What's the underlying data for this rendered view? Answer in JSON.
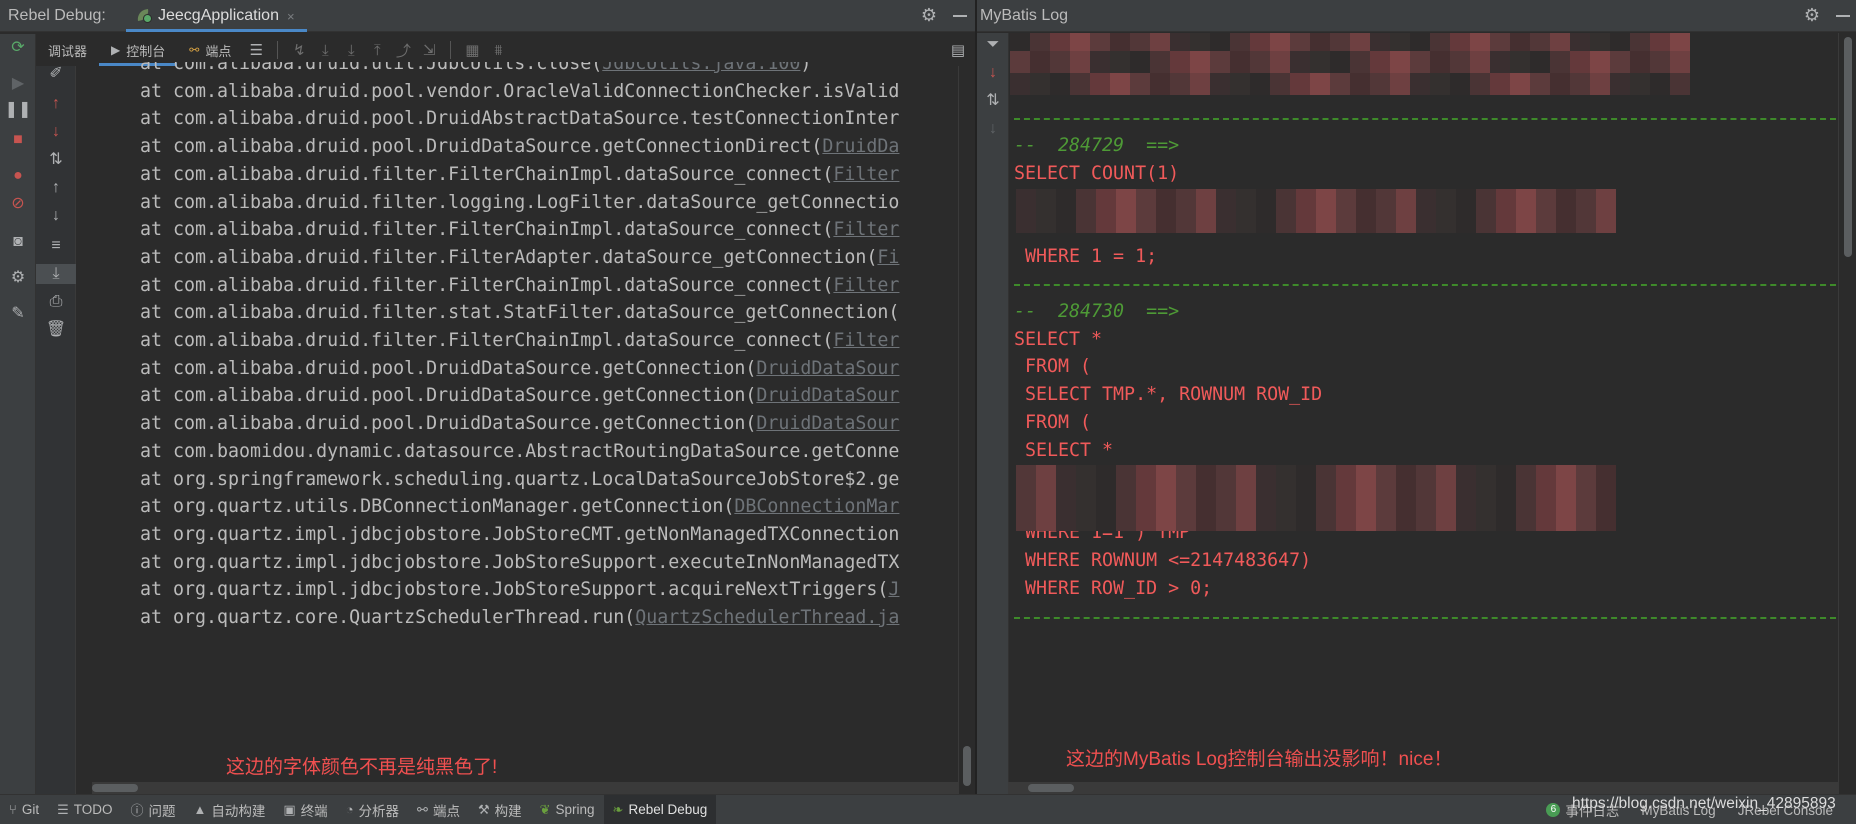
{
  "left_panel": {
    "title": "Rebel Debug:",
    "tab_label": "JeecgApplication",
    "tab_close": "×",
    "subtabs": [
      {
        "label": "调试器",
        "icon": ""
      },
      {
        "label": "控制台",
        "icon": "▶"
      },
      {
        "label": "端点",
        "icon": "⚯"
      }
    ],
    "stack_trace": [
      {
        "text": "at com.alibaba.druid.util.JdbcUtils.close(",
        "loc": "JdbcUtils.java:100",
        "tail": ")"
      },
      {
        "text": "at com.alibaba.druid.pool.vendor.OracleValidConnectionChecker.isValid",
        "loc": "",
        "tail": ""
      },
      {
        "text": "at com.alibaba.druid.pool.DruidAbstractDataSource.testConnectionInter",
        "loc": "",
        "tail": ""
      },
      {
        "text": "at com.alibaba.druid.pool.DruidDataSource.getConnectionDirect(",
        "loc": "DruidDa",
        "tail": ""
      },
      {
        "text": "at com.alibaba.druid.filter.FilterChainImpl.dataSource_connect(",
        "loc": "Filter",
        "tail": ""
      },
      {
        "text": "at com.alibaba.druid.filter.logging.LogFilter.dataSource_getConnectio",
        "loc": "",
        "tail": ""
      },
      {
        "text": "at com.alibaba.druid.filter.FilterChainImpl.dataSource_connect(",
        "loc": "Filter",
        "tail": ""
      },
      {
        "text": "at com.alibaba.druid.filter.FilterAdapter.dataSource_getConnection(",
        "loc": "Fi",
        "tail": ""
      },
      {
        "text": "at com.alibaba.druid.filter.FilterChainImpl.dataSource_connect(",
        "loc": "Filter",
        "tail": ""
      },
      {
        "text": "at com.alibaba.druid.filter.stat.StatFilter.dataSource_getConnection(",
        "loc": "",
        "tail": ""
      },
      {
        "text": "at com.alibaba.druid.filter.FilterChainImpl.dataSource_connect(",
        "loc": "Filter",
        "tail": ""
      },
      {
        "text": "at com.alibaba.druid.pool.DruidDataSource.getConnection(",
        "loc": "DruidDataSour",
        "tail": ""
      },
      {
        "text": "at com.alibaba.druid.pool.DruidDataSource.getConnection(",
        "loc": "DruidDataSour",
        "tail": ""
      },
      {
        "text": "at com.alibaba.druid.pool.DruidDataSource.getConnection(",
        "loc": "DruidDataSour",
        "tail": ""
      },
      {
        "text": "at com.baomidou.dynamic.datasource.AbstractRoutingDataSource.getConne",
        "loc": "",
        "tail": ""
      },
      {
        "text": "at org.springframework.scheduling.quartz.LocalDataSourceJobStore$2.ge",
        "loc": "",
        "tail": ""
      },
      {
        "text": "at org.quartz.utils.DBConnectionManager.getConnection(",
        "loc": "DBConnectionMar",
        "tail": ""
      },
      {
        "text": "at org.quartz.impl.jdbcjobstore.JobStoreCMT.getNonManagedTXConnection",
        "loc": "",
        "tail": ""
      },
      {
        "text": "at org.quartz.impl.jdbcjobstore.JobStoreSupport.executeInNonManagedTX",
        "loc": "",
        "tail": ""
      },
      {
        "text": "at org.quartz.impl.jdbcjobstore.JobStoreSupport.acquireNextTriggers(",
        "loc": "J",
        "tail": ""
      },
      {
        "text": "at org.quartz.core.QuartzSchedulerThread.run(",
        "loc": "QuartzSchedulerThread.ja",
        "tail": ""
      }
    ],
    "note": "这边的字体颜色不再是纯黑色了!"
  },
  "right_panel": {
    "title": "MyBatis Log",
    "sql_lines": [
      {
        "kind": "divider"
      },
      {
        "kind": "comment",
        "text": "--  284729  ==>"
      },
      {
        "kind": "sql",
        "text": "SELECT COUNT(1)"
      },
      {
        "kind": "sql",
        "text": " WHERE 1 = 1;"
      },
      {
        "kind": "divider"
      },
      {
        "kind": "comment",
        "text": "--  284730  ==>"
      },
      {
        "kind": "sql",
        "text": "SELECT *"
      },
      {
        "kind": "sql",
        "text": " FROM ("
      },
      {
        "kind": "sql",
        "text": " SELECT TMP.*, ROWNUM ROW_ID"
      },
      {
        "kind": "sql",
        "text": " FROM ("
      },
      {
        "kind": "sql",
        "text": " SELECT *"
      },
      {
        "kind": "sql",
        "text": " WHERE 1=1 ) TMP"
      },
      {
        "kind": "sql",
        "text": " WHERE ROWNUM <=2147483647)"
      },
      {
        "kind": "sql",
        "text": " WHERE ROW_ID > 0;"
      },
      {
        "kind": "divider"
      }
    ],
    "note": "这边的MyBatis Log控制台输出没影响！nice！"
  },
  "statusbar": {
    "items": [
      {
        "label": "Git",
        "icon": "⑂"
      },
      {
        "label": "TODO",
        "icon": "☰"
      },
      {
        "label": "问题",
        "icon": "ⓘ"
      },
      {
        "label": "自动构建",
        "icon": "▲"
      },
      {
        "label": "终端",
        "icon": "▣"
      },
      {
        "label": "分析器",
        "icon": "◔"
      },
      {
        "label": "端点",
        "icon": "⚯"
      },
      {
        "label": "构建",
        "icon": "⚒"
      },
      {
        "label": "Spring",
        "icon": "❦"
      },
      {
        "label": "Rebel Debug",
        "icon": "❧"
      }
    ],
    "right_items": [
      {
        "label": "事件日志",
        "badge": "6"
      },
      {
        "label": "MyBatis Log",
        "badge": ""
      },
      {
        "label": "JRebel Console",
        "badge": ""
      }
    ],
    "watermark": "https://blog.csdn.net/weixin_42895893"
  },
  "colors": {
    "sql_red": "#f05a5a",
    "comment_green": "#4e9a36",
    "accent_blue": "#4a88c7",
    "note_red": "#f05050"
  }
}
